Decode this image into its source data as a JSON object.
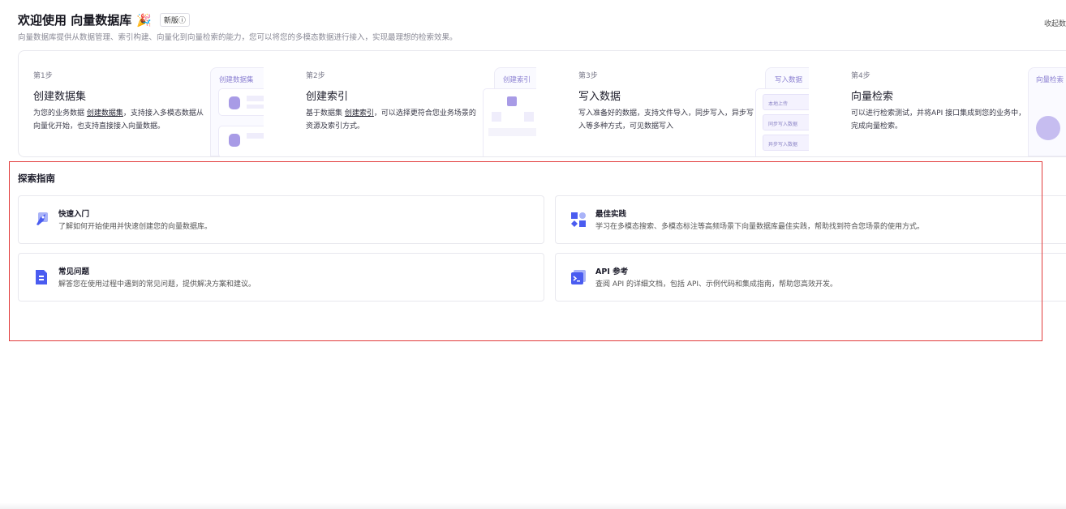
{
  "header": {
    "title": "欢迎使用 向量数据库",
    "emoji": "🎉",
    "badge": "新版ⓘ",
    "subtitle": "向量数据库提供从数据管理、索引构建、向量化到向量检索的能力，您可以将您的多模态数据进行接入，实现最理想的检索效果。",
    "collapse": "收起数"
  },
  "steps": [
    {
      "no": "第1步",
      "name": "创建数据集",
      "desc_pre": "为您的业务数据 ",
      "link": "创建数据集",
      "desc_post": "，支持接入多模态数据从向量化开始，也支持直接接入向量数据。",
      "tab": "创建数据集"
    },
    {
      "no": "第2步",
      "name": "创建索引",
      "desc_pre": "基于数据集 ",
      "link": "创建索引",
      "desc_post": "，可以选择更符合您业务场景的资源及索引方式。",
      "tab": "创建索引"
    },
    {
      "no": "第3步",
      "name": "写入数据",
      "desc_pre": "写入准备好的数据，支持文件导入，同步写入，异步写入等多种方式，可见数据写入",
      "link": "",
      "desc_post": "",
      "tab": "写入数据",
      "rows": [
        "本地上传",
        "同步写入数据",
        "异步写入数据"
      ]
    },
    {
      "no": "第4步",
      "name": "向量检索",
      "desc_pre": "可以进行检索测试，并将API 接口集成到您的业务中，完成向量检索。",
      "link": "",
      "desc_post": "",
      "tab": "向量检索"
    }
  ],
  "explore": {
    "title": "探索指南",
    "cards": [
      {
        "title": "快速入门",
        "desc": "了解如何开始使用并快速创建您的向量数据库。",
        "icon": "rocket-icon"
      },
      {
        "title": "最佳实践",
        "desc": "学习在多模态搜索、多模态标注等高频场景下向量数据库最佳实践，帮助找到符合您场景的使用方式。",
        "icon": "shapes-icon"
      },
      {
        "title": "常见问题",
        "desc": "解答您在使用过程中遇到的常见问题，提供解决方案和建议。",
        "icon": "document-icon"
      },
      {
        "title": "API 参考",
        "desc": "查阅 API 的详细文档，包括 API、示例代码和集成指南，帮助您高效开发。",
        "icon": "terminal-icon"
      }
    ]
  },
  "colors": {
    "accent": "#4a5cf0",
    "illustration": "#a89be6",
    "highlight_box": "#e23b3b"
  }
}
